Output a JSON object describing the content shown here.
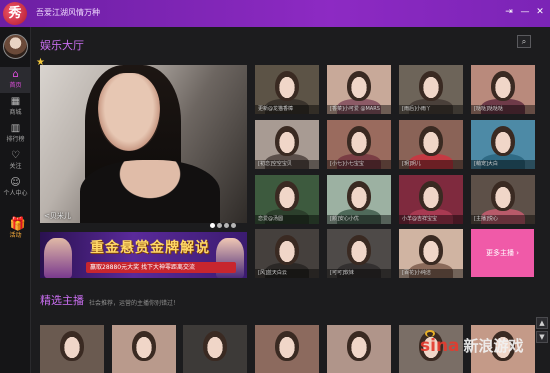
{
  "titlebar": {
    "logo_char": "秀",
    "items": [
      "吾爱江湖",
      "风情万种"
    ],
    "controls": [
      "⇥",
      "—",
      "✕"
    ]
  },
  "sidebar": {
    "items": [
      {
        "icon": "home-icon",
        "glyph": "⌂",
        "label": "首页",
        "active": true
      },
      {
        "icon": "store-icon",
        "glyph": "▦",
        "label": "商城",
        "active": false
      },
      {
        "icon": "ranking-icon",
        "glyph": "▥",
        "label": "排行榜",
        "active": false
      },
      {
        "icon": "heart-icon",
        "glyph": "♡",
        "label": "关注",
        "active": false
      },
      {
        "icon": "user-icon",
        "glyph": "☺",
        "label": "个人中心",
        "active": false
      },
      {
        "icon": "gift-icon",
        "glyph": "🎁",
        "label": "活动",
        "active": false
      }
    ]
  },
  "main": {
    "title": "娱乐大厅",
    "search_icon": "⌕",
    "hero_caption": "<贝米儿",
    "banner": {
      "title": "重金悬赏金牌解说",
      "sub": "赢取28880元大奖 找下大神零距离交流"
    },
    "thumbs": [
      {
        "cap": "更新@龙猫香樟",
        "bg": "#5c5346",
        "sh": "#3a332c"
      },
      {
        "cap": "[香菜]小可爱 @MARS",
        "bg": "#c8a999",
        "sh": "#8c5a66"
      },
      {
        "cap": "[雨后]小雨丫",
        "bg": "#6d6459",
        "sh": "#4a403a"
      },
      {
        "cap": "[哒哒]哒哒哒",
        "bg": "#b98a7c",
        "sh": "#6e3a48"
      },
      {
        "cap": "[初恋]空空宝贝",
        "bg": "#a89b93",
        "sh": "#5b4f4a"
      },
      {
        "cap": "[小七]小七宝宝",
        "bg": "#9a6b5e",
        "sh": "#7a3d44"
      },
      {
        "cap": "[玥]玥儿",
        "bg": "#8a6357",
        "sh": "#c43a43"
      },
      {
        "cap": "[萌宠]大白",
        "bg": "#4d8aa6",
        "sh": "#2f6a84"
      },
      {
        "cap": "恋爱@汤圆",
        "bg": "#3d5a3e",
        "sh": "#2c3f2c"
      },
      {
        "cap": "[颜]安心小优",
        "bg": "#9cb1a2",
        "sh": "#4f6a5a"
      },
      {
        "cap": "小羊@吉祥宝宝",
        "bg": "#7f2a3e",
        "sh": "#a83a52"
      },
      {
        "cap": "[主播]悦心",
        "bg": "#5d5048",
        "sh": "#b85a6a"
      },
      {
        "cap": "[风]蓝天白云",
        "bg": "#45403d",
        "sh": "#2b2826"
      },
      {
        "cap": "[可可]软妹",
        "bg": "#4e4a48",
        "sh": "#333030"
      },
      {
        "cap": "[百花]小纯洁",
        "bg": "#d0b4a2",
        "sh": "#8a6a5a"
      }
    ],
    "more_label": "更多主播 ›",
    "section2_title": "精选主播",
    "section2_note": "社会推荐，运营的主播你别错过！",
    "bottom_thumbs": [
      {
        "bg": "#6a5a50"
      },
      {
        "bg": "#b99a8c"
      },
      {
        "bg": "#3d3a38"
      },
      {
        "bg": "#8c6a5e"
      },
      {
        "bg": "#b0958a"
      },
      {
        "bg": "#7a6e66"
      },
      {
        "bg": "#c49a88"
      }
    ],
    "scroll_up": "▲",
    "scroll_down": "▼"
  },
  "watermark": {
    "sina": "sina",
    "zh": "新浪游戏"
  },
  "colors": {
    "accent": "#c96ef0",
    "titlebar": "#7b24b6",
    "more_button": "#f05aa8"
  }
}
